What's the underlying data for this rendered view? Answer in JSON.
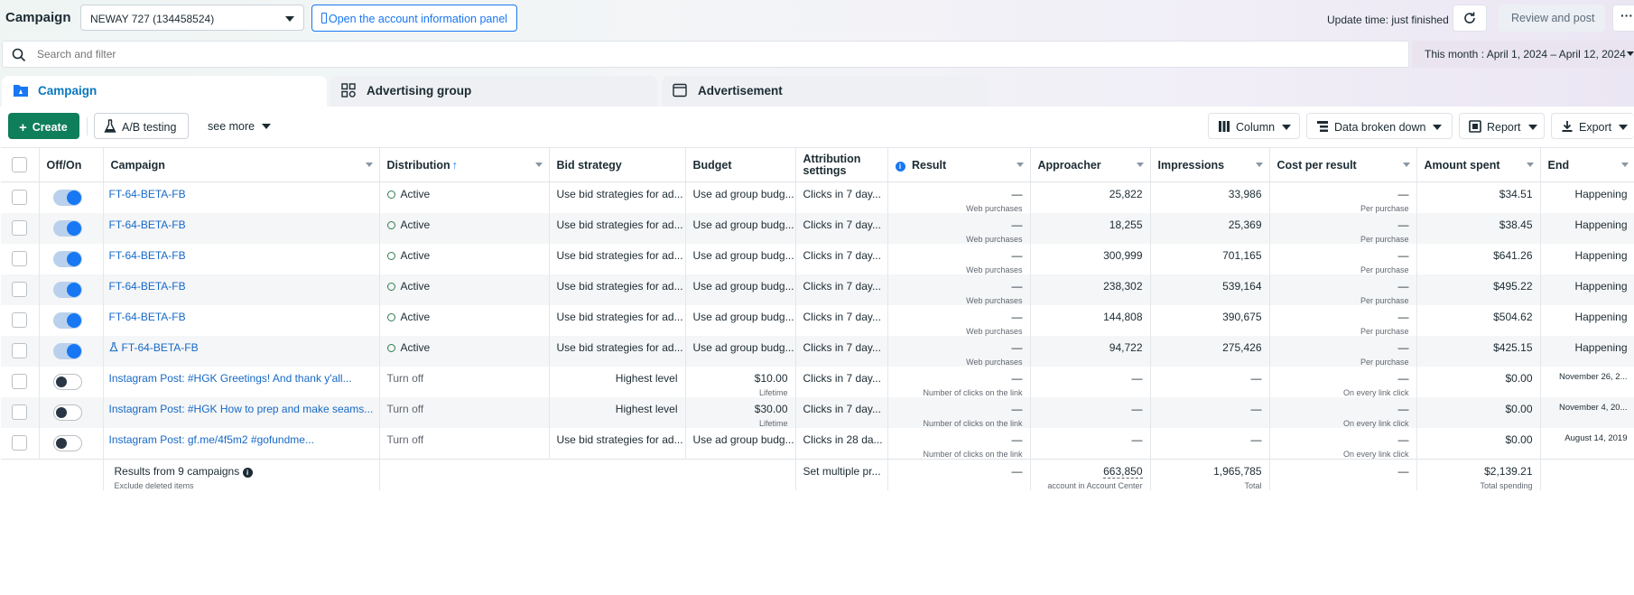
{
  "header": {
    "title": "Campaign",
    "account_select": "NEWAY 727 (134458524)",
    "open_account_panel": "Open the account information panel",
    "update_time": "Update time: just finished",
    "review_post": "Review and post",
    "more": "···"
  },
  "search": {
    "placeholder": "Search and filter"
  },
  "date_range": "This month : April 1, 2024 – April 12, 2024",
  "tabs": [
    {
      "label": "Campaign",
      "active": true
    },
    {
      "label": "Advertising group",
      "active": false
    },
    {
      "label": "Advertisement",
      "active": false
    }
  ],
  "toolbar": {
    "create": "Create",
    "ab_testing": "A/B testing",
    "see_more": "see more",
    "column": "Column",
    "breakdown": "Data broken down",
    "report": "Report",
    "export": "Export"
  },
  "columns": {
    "offon": "Off/On",
    "campaign": "Campaign",
    "distribution": "Distribution",
    "bid_strategy": "Bid strategy",
    "budget": "Budget",
    "attribution": "Attribution settings",
    "result": "Result",
    "approacher": "Approacher",
    "impressions": "Impressions",
    "cost_per_result": "Cost per result",
    "amount_spent": "Amount spent",
    "end": "End"
  },
  "rows": [
    {
      "on": true,
      "name": "FT-64-BETA-FB",
      "flask": false,
      "status": "Active",
      "bid": "Use bid strategies for ad...",
      "budget": "Use ad group budg...",
      "budget_sub": "",
      "attr": "Clicks in 7 day...",
      "result": "—",
      "result_sub": "Web purchases",
      "reach": "25,822",
      "impr": "33,986",
      "cpr": "—",
      "cpr_sub": "Per purchase",
      "spent": "$34.51",
      "end": "Happening"
    },
    {
      "on": true,
      "name": "FT-64-BETA-FB",
      "flask": false,
      "status": "Active",
      "bid": "Use bid strategies for ad...",
      "budget": "Use ad group budg...",
      "budget_sub": "",
      "attr": "Clicks in 7 day...",
      "result": "—",
      "result_sub": "Web purchases",
      "reach": "18,255",
      "impr": "25,369",
      "cpr": "—",
      "cpr_sub": "Per purchase",
      "spent": "$38.45",
      "end": "Happening"
    },
    {
      "on": true,
      "name": "FT-64-BETA-FB",
      "flask": false,
      "status": "Active",
      "bid": "Use bid strategies for ad...",
      "budget": "Use ad group budg...",
      "budget_sub": "",
      "attr": "Clicks in 7 day...",
      "result": "—",
      "result_sub": "Web purchases",
      "reach": "300,999",
      "impr": "701,165",
      "cpr": "—",
      "cpr_sub": "Per purchase",
      "spent": "$641.26",
      "end": "Happening"
    },
    {
      "on": true,
      "name": "FT-64-BETA-FB",
      "flask": false,
      "status": "Active",
      "bid": "Use bid strategies for ad...",
      "budget": "Use ad group budg...",
      "budget_sub": "",
      "attr": "Clicks in 7 day...",
      "result": "—",
      "result_sub": "Web purchases",
      "reach": "238,302",
      "impr": "539,164",
      "cpr": "—",
      "cpr_sub": "Per purchase",
      "spent": "$495.22",
      "end": "Happening"
    },
    {
      "on": true,
      "name": "FT-64-BETA-FB",
      "flask": false,
      "status": "Active",
      "bid": "Use bid strategies for ad...",
      "budget": "Use ad group budg...",
      "budget_sub": "",
      "attr": "Clicks in 7 day...",
      "result": "—",
      "result_sub": "Web purchases",
      "reach": "144,808",
      "impr": "390,675",
      "cpr": "—",
      "cpr_sub": "Per purchase",
      "spent": "$504.62",
      "end": "Happening"
    },
    {
      "on": true,
      "name": "FT-64-BETA-FB",
      "flask": true,
      "status": "Active",
      "bid": "Use bid strategies for ad...",
      "budget": "Use ad group budg...",
      "budget_sub": "",
      "attr": "Clicks in 7 day...",
      "result": "—",
      "result_sub": "Web purchases",
      "reach": "94,722",
      "impr": "275,426",
      "cpr": "—",
      "cpr_sub": "Per purchase",
      "spent": "$425.15",
      "end": "Happening"
    },
    {
      "on": false,
      "name": "Instagram Post: #HGK Greetings! And thank y'all...",
      "flask": false,
      "status": "Turn off",
      "bid": "Highest level",
      "budget": "$10.00",
      "budget_sub": "Lifetime",
      "attr": "Clicks in 7 day...",
      "result": "—",
      "result_sub": "Number of clicks on the link",
      "reach": "—",
      "impr": "—",
      "cpr": "—",
      "cpr_sub": "On every link click",
      "spent": "$0.00",
      "end": "November 26, 2..."
    },
    {
      "on": false,
      "name": "Instagram Post: #HGK How to prep and make seams...",
      "flask": false,
      "status": "Turn off",
      "bid": "Highest level",
      "budget": "$30.00",
      "budget_sub": "Lifetime",
      "attr": "Clicks in 7 day...",
      "result": "—",
      "result_sub": "Number of clicks on the link",
      "reach": "—",
      "impr": "—",
      "cpr": "—",
      "cpr_sub": "On every link click",
      "spent": "$0.00",
      "end": "November 4, 20..."
    },
    {
      "on": false,
      "name": "Instagram Post: gf.me/4f5m2 #gofundme...",
      "flask": false,
      "status": "Turn off",
      "bid": "Use bid strategies for ad...",
      "budget": "Use ad group budg...",
      "budget_sub": "",
      "attr": "Clicks in 28 da...",
      "result": "—",
      "result_sub": "Number of clicks on the link",
      "reach": "—",
      "impr": "—",
      "cpr": "—",
      "cpr_sub": "On every link click",
      "spent": "$0.00",
      "end": "August 14, 2019"
    }
  ],
  "totals": {
    "label": "Results from 9 campaigns",
    "sub": "Exclude deleted items",
    "attr": "Set multiple pr...",
    "result": "—",
    "reach": "663,850",
    "reach_sub": "account in Account Center",
    "impr": "1,965,785",
    "impr_sub": "Total",
    "cpr": "—",
    "spent": "$2,139.21",
    "spent_sub": "Total spending"
  },
  "colors": {
    "accent": "#1877f2",
    "create_bg": "#0f7e5a",
    "active_tab": "#0a78be"
  }
}
